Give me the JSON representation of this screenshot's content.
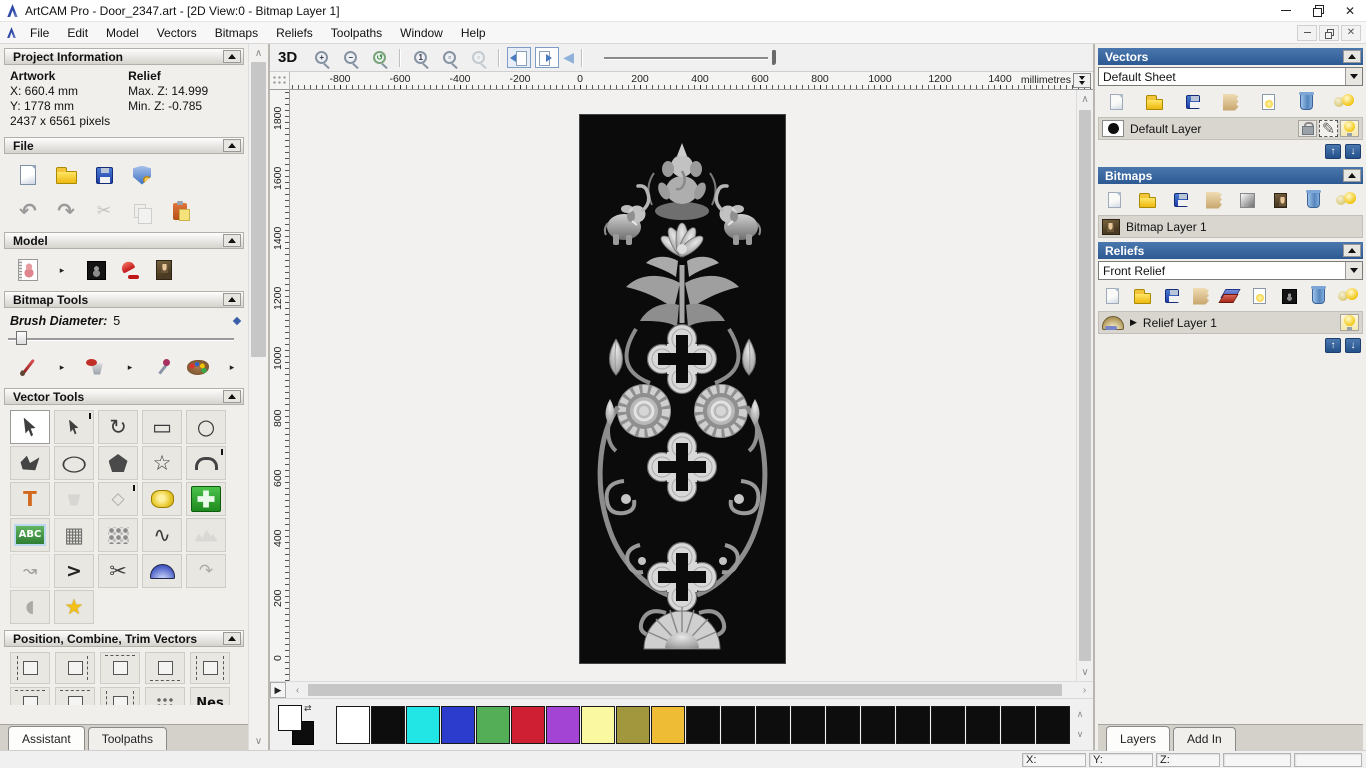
{
  "window": {
    "title": "ArtCAM Pro - Door_2347.art - [2D View:0 - Bitmap Layer 1]",
    "controls": [
      {
        "name": "minimize-button",
        "cls": "wc-min",
        "glyph": ""
      },
      {
        "name": "restore-button",
        "cls": "wc-rest",
        "glyph": ""
      },
      {
        "name": "close-button",
        "cls": "wc-close",
        "glyph": "✕"
      }
    ],
    "mdi_controls": [
      {
        "name": "mdi-minimize-button",
        "cls": "mdi-min",
        "glyph": ""
      },
      {
        "name": "mdi-restore-button",
        "cls": "mdi-rest",
        "glyph": ""
      },
      {
        "name": "mdi-close-button",
        "cls": "mdi-close",
        "glyph": "✕"
      }
    ]
  },
  "menu": {
    "items": [
      {
        "label": "File",
        "name": "menu-file"
      },
      {
        "label": "Edit",
        "name": "menu-edit"
      },
      {
        "label": "Model",
        "name": "menu-model"
      },
      {
        "label": "Vectors",
        "name": "menu-vectors"
      },
      {
        "label": "Bitmaps",
        "name": "menu-bitmaps"
      },
      {
        "label": "Reliefs",
        "name": "menu-reliefs"
      },
      {
        "label": "Toolpaths",
        "name": "menu-toolpaths"
      },
      {
        "label": "Window",
        "name": "menu-window"
      },
      {
        "label": "Help",
        "name": "menu-help"
      }
    ]
  },
  "assistant": {
    "project_information": {
      "title": "Project Information",
      "artwork_heading": "Artwork",
      "relief_heading": "Relief",
      "artwork_x": "X: 660.4 mm",
      "artwork_y": "Y: 1778 mm",
      "artwork_pixels": "2437 x 6561 pixels",
      "relief_max": "Max. Z: 14.999",
      "relief_min": "Min. Z: -0.785"
    },
    "file": {
      "title": "File",
      "row1": [
        {
          "name": "new-model-button",
          "cls": "ic-page"
        },
        {
          "name": "open-model-button",
          "cls": "ic-folder"
        },
        {
          "name": "save-model-button",
          "cls": "ic-floppy"
        },
        {
          "name": "license-export-button",
          "cls": "ic-shield"
        }
      ],
      "row2": [
        {
          "name": "undo-button",
          "cls": "gly g22",
          "glyph": "↶"
        },
        {
          "name": "redo-button",
          "cls": "gly g22",
          "glyph": "↷"
        },
        {
          "name": "cut-button",
          "cls": "gly g18 dim",
          "glyph": "✂"
        },
        {
          "name": "copy-button",
          "cls": "ic-copy dim"
        },
        {
          "name": "paste-button",
          "cls": "ic-clip"
        }
      ]
    },
    "model": {
      "title": "Model",
      "icons": [
        {
          "name": "set-model-size-button",
          "cls": "ic-sketch"
        },
        {
          "name": "flyout-arrow-icon",
          "cls": "fly",
          "glyph": "▸"
        },
        {
          "name": "adjust-model-button",
          "cls": "ic-darksq"
        },
        {
          "name": "lighting-button",
          "cls": "ic-lamp"
        },
        {
          "name": "load-image-button",
          "cls": "ic-mona"
        }
      ]
    },
    "bitmap_tools": {
      "title": "Bitmap Tools",
      "brush_label": "Brush Diameter:",
      "brush_value": "5",
      "icons": [
        {
          "name": "paint-brush-button",
          "cls": "ic-brush"
        },
        {
          "name": "flyout-arrow-icon",
          "cls": "fly",
          "glyph": "▸"
        },
        {
          "name": "flood-fill-button",
          "cls": "ic-bucket2"
        },
        {
          "name": "flyout-arrow-icon",
          "cls": "fly",
          "glyph": "▸"
        },
        {
          "name": "colour-picker-button",
          "cls": "ic-dropper"
        },
        {
          "name": "palette-button",
          "cls": "ic-palette"
        },
        {
          "name": "flyout-arrow-icon",
          "cls": "fly",
          "glyph": "▸"
        },
        {
          "name": "texture-sponge-button",
          "cls": "ic-sponge"
        }
      ]
    },
    "vector_tools": {
      "title": "Vector Tools",
      "tools": [
        {
          "name": "select-vectors-tool",
          "cls": "shp-cursor active"
        },
        {
          "name": "node-editing-tool",
          "cls": "shp-cursor sm pin"
        },
        {
          "name": "transform-vectors-tool",
          "cls": "big",
          "glyph": "↻"
        },
        {
          "name": "create-rectangle-tool",
          "cls": "big",
          "glyph": "▭"
        },
        {
          "name": "create-circle-tool",
          "cls": "big",
          "glyph": "○"
        },
        {
          "name": "create-polyline-tool",
          "cls": "shp-poly"
        },
        {
          "name": "create-ellipse-tool",
          "cls": "big stretchx",
          "glyph": "○"
        },
        {
          "name": "create-polygon-tool",
          "cls": "shp-pentagon"
        },
        {
          "name": "create-star-tool",
          "cls": "big",
          "glyph": "☆"
        },
        {
          "name": "create-arc-tool",
          "cls": "shp-arc pin"
        },
        {
          "name": "create-text-tool",
          "cls": "txt-orange",
          "glyph": "T"
        },
        {
          "name": "flood-fill-vector-tool",
          "cls": "shp-bucket dis"
        },
        {
          "name": "offset-vectors-tool",
          "cls": "dis pin",
          "glyph": "◇"
        },
        {
          "name": "measure-tool",
          "cls": "shp-tape"
        },
        {
          "name": "vector-doctor-tool",
          "cls": "shp-greencross"
        },
        {
          "name": "wrap-text-tool",
          "cls": "shp-abc",
          "glyph": "ABC"
        },
        {
          "name": "distort-vectors-tool",
          "cls": "big dim2",
          "glyph": "▦"
        },
        {
          "name": "paste-along-curve-tool",
          "cls": "shp-dots"
        },
        {
          "name": "free-polyline-tool",
          "cls": "big",
          "glyph": "∿"
        },
        {
          "name": "vector-texture-tool",
          "cls": "shp-mtn dis"
        },
        {
          "name": "fit-curve-tool",
          "cls": "dim",
          "glyph": "↝"
        },
        {
          "name": "join-vectors-tool",
          "cls": "bold",
          "glyph": ">"
        },
        {
          "name": "trim-vectors-tool",
          "cls": "big",
          "glyph": "✂"
        },
        {
          "name": "spin-profile-tool",
          "cls": "shp-dome"
        },
        {
          "name": "extrude-tool",
          "cls": "dis",
          "glyph": "↷"
        },
        {
          "name": "slice-profile-tool",
          "cls": "dis",
          "glyph": "◖"
        },
        {
          "name": "create-boundary-tool",
          "cls": "gold",
          "glyph": "★"
        }
      ]
    },
    "position_tools": {
      "title": "Position, Combine, Trim Vectors",
      "row1": [
        {
          "name": "align-left-button",
          "cls": "shp-align al-l"
        },
        {
          "name": "align-right-button",
          "cls": "shp-align al-r"
        },
        {
          "name": "align-top-button",
          "cls": "shp-align al-t"
        },
        {
          "name": "align-bottom-button",
          "cls": "shp-align al-b"
        },
        {
          "name": "centre-horizontal-button",
          "cls": "shp-align al-c"
        }
      ],
      "row2": [
        {
          "name": "align-centre-button",
          "cls": "shp-align al-t"
        },
        {
          "name": "align-middle-button",
          "cls": "shp-align al-t"
        },
        {
          "name": "align-spread-button",
          "cls": "shp-align al-c"
        },
        {
          "name": "paste-array-button",
          "cls": "shp-scatter"
        },
        {
          "name": "nesting-button",
          "cls": "nes",
          "glyph": "Nes"
        }
      ]
    },
    "tabs": [
      {
        "label": "Assistant",
        "name": "tab-assistant",
        "cls": "active"
      },
      {
        "label": "Toolpaths",
        "name": "tab-toolpaths",
        "cls": ""
      }
    ]
  },
  "canvas": {
    "toolbar": {
      "view3d": "3D",
      "items": [
        {
          "name": "zoom-in-button",
          "cls": "mg",
          "glyph": "+"
        },
        {
          "name": "zoom-out-button",
          "cls": "mg",
          "glyph": "−"
        },
        {
          "name": "zoom-previous-button",
          "cls": "mg grn",
          "glyph": "↺"
        },
        {
          "name": "toolbar-separator",
          "cls": "sep"
        },
        {
          "name": "zoom-1to1-button",
          "cls": "mg",
          "glyph": "1"
        },
        {
          "name": "zoom-fit-button",
          "cls": "mg",
          "glyph": "▫"
        },
        {
          "name": "zoom-selection-button",
          "cls": "mg dis",
          "glyph": "▫"
        },
        {
          "name": "toolbar-separator",
          "cls": "sep"
        },
        {
          "name": "previous-layer-view-button",
          "cls": "tbtn pl sel"
        },
        {
          "name": "next-layer-view-button",
          "cls": "tbtn"
        },
        {
          "name": "preview-back-button",
          "cls": "barrow",
          "glyph": "◀"
        },
        {
          "name": "toolbar-separator",
          "cls": "sep"
        }
      ]
    },
    "ruler_top": {
      "labels": [
        "-800",
        "-600",
        "-400",
        "-200",
        "0",
        "200",
        "400",
        "600",
        "800",
        "1000",
        "1200",
        "1400"
      ],
      "unit": "millimetres"
    },
    "ruler_left": {
      "labels": [
        "1800",
        "1600",
        "1400",
        "1200",
        "1000",
        "800",
        "600",
        "400",
        "200",
        "0"
      ]
    }
  },
  "palette": {
    "colors": [
      "#ffffff",
      "#0d0d0d",
      "#22e6e6",
      "#2c3ccc",
      "#54ae57",
      "#cf1f32",
      "#a344d4",
      "#fbf8a2",
      "#a3973e",
      "#eebc35",
      "#0d0d0d",
      "#0d0d0d",
      "#0d0d0d",
      "#0d0d0d",
      "#0d0d0d",
      "#0d0d0d",
      "#0d0d0d",
      "#0d0d0d",
      "#0d0d0d",
      "#0d0d0d",
      "#0d0d0d"
    ]
  },
  "right": {
    "vectors": {
      "title": "Vectors",
      "sheet": "Default Sheet",
      "toolbar": [
        {
          "name": "new-vector-layer-button",
          "cls": "ic-page pg-sm dim2"
        },
        {
          "name": "open-vector-layer-button",
          "cls": "ic-folder fo-sm"
        },
        {
          "name": "save-vector-layer-button",
          "cls": "ic-floppy fl-sm"
        },
        {
          "name": "merge-vector-layers-button",
          "cls": "ic-paper"
        },
        {
          "name": "toggle-layer-visibility-button",
          "cls": "ic-bulbpage"
        },
        {
          "name": "delete-vector-layer-button",
          "cls": "ic-trash"
        },
        {
          "name": "toggle-all-layers-button",
          "cls": "ic-bulbs"
        }
      ],
      "layer": "Default Layer",
      "layer_buttons": [
        {
          "name": "lock-layer-button",
          "cls": "",
          "icon": "ic-lock"
        },
        {
          "name": "edit-layer-button",
          "cls": "sel",
          "icon": "gly",
          "glyph": "✎"
        },
        {
          "name": "layer-visibility-button",
          "cls": "lit",
          "icon": "ic-bulb"
        }
      ]
    },
    "bitmaps": {
      "title": "Bitmaps",
      "toolbar": [
        {
          "name": "new-bitmap-layer-button",
          "cls": "ic-page pg-sm dim2"
        },
        {
          "name": "open-bitmap-layer-button",
          "cls": "ic-folder fo-sm"
        },
        {
          "name": "save-bitmap-layer-button",
          "cls": "ic-floppy fl-sm"
        },
        {
          "name": "merge-bitmap-layers-button",
          "cls": "ic-paper"
        },
        {
          "name": "colour-blend-button",
          "cls": "ic-gradsq"
        },
        {
          "name": "bitmap-preview-button",
          "cls": "ic-mona mo-sm"
        },
        {
          "name": "delete-bitmap-layer-button",
          "cls": "ic-trash"
        },
        {
          "name": "toggle-all-bitmap-layers-button",
          "cls": "ic-bulbs"
        }
      ],
      "layer": "Bitmap Layer 1"
    },
    "reliefs": {
      "title": "Reliefs",
      "sheet": "Front Relief",
      "toolbar": [
        {
          "name": "new-relief-layer-button",
          "cls": "ic-page pg-sm dim2"
        },
        {
          "name": "open-relief-layer-button",
          "cls": "ic-folder fo-sm"
        },
        {
          "name": "save-relief-layer-button",
          "cls": "ic-floppy fl-sm"
        },
        {
          "name": "merge-relief-layers-button",
          "cls": "ic-paper"
        },
        {
          "name": "combine-relief-button",
          "cls": "ic-layers"
        },
        {
          "name": "toggle-relief-visibility-button",
          "cls": "ic-bulbpage"
        },
        {
          "name": "greyscale-preview-button",
          "cls": "ic-darksq dk-sm"
        },
        {
          "name": "delete-relief-layer-button",
          "cls": "ic-trash"
        },
        {
          "name": "toggle-all-relief-layers-button",
          "cls": "ic-bulbs"
        }
      ],
      "layer": "Relief Layer 1"
    },
    "tabs": [
      {
        "label": "Layers",
        "name": "tab-layers",
        "cls": "active"
      },
      {
        "label": "Add In",
        "name": "tab-add-in",
        "cls": ""
      }
    ]
  },
  "status": {
    "fields": [
      {
        "label": "X:",
        "name": "status-x-field",
        "cls": ""
      },
      {
        "label": "Y:",
        "name": "status-y-field",
        "cls": ""
      },
      {
        "label": "Z:",
        "name": "status-z-field",
        "cls": ""
      },
      {
        "label": "",
        "name": "status-extra-field-1",
        "cls": "wide"
      },
      {
        "label": "",
        "name": "status-extra-field-2",
        "cls": "wide"
      }
    ]
  },
  "colors": {
    "header_blue": "#2d5a92",
    "artwork_background": "#0b0b0b"
  }
}
